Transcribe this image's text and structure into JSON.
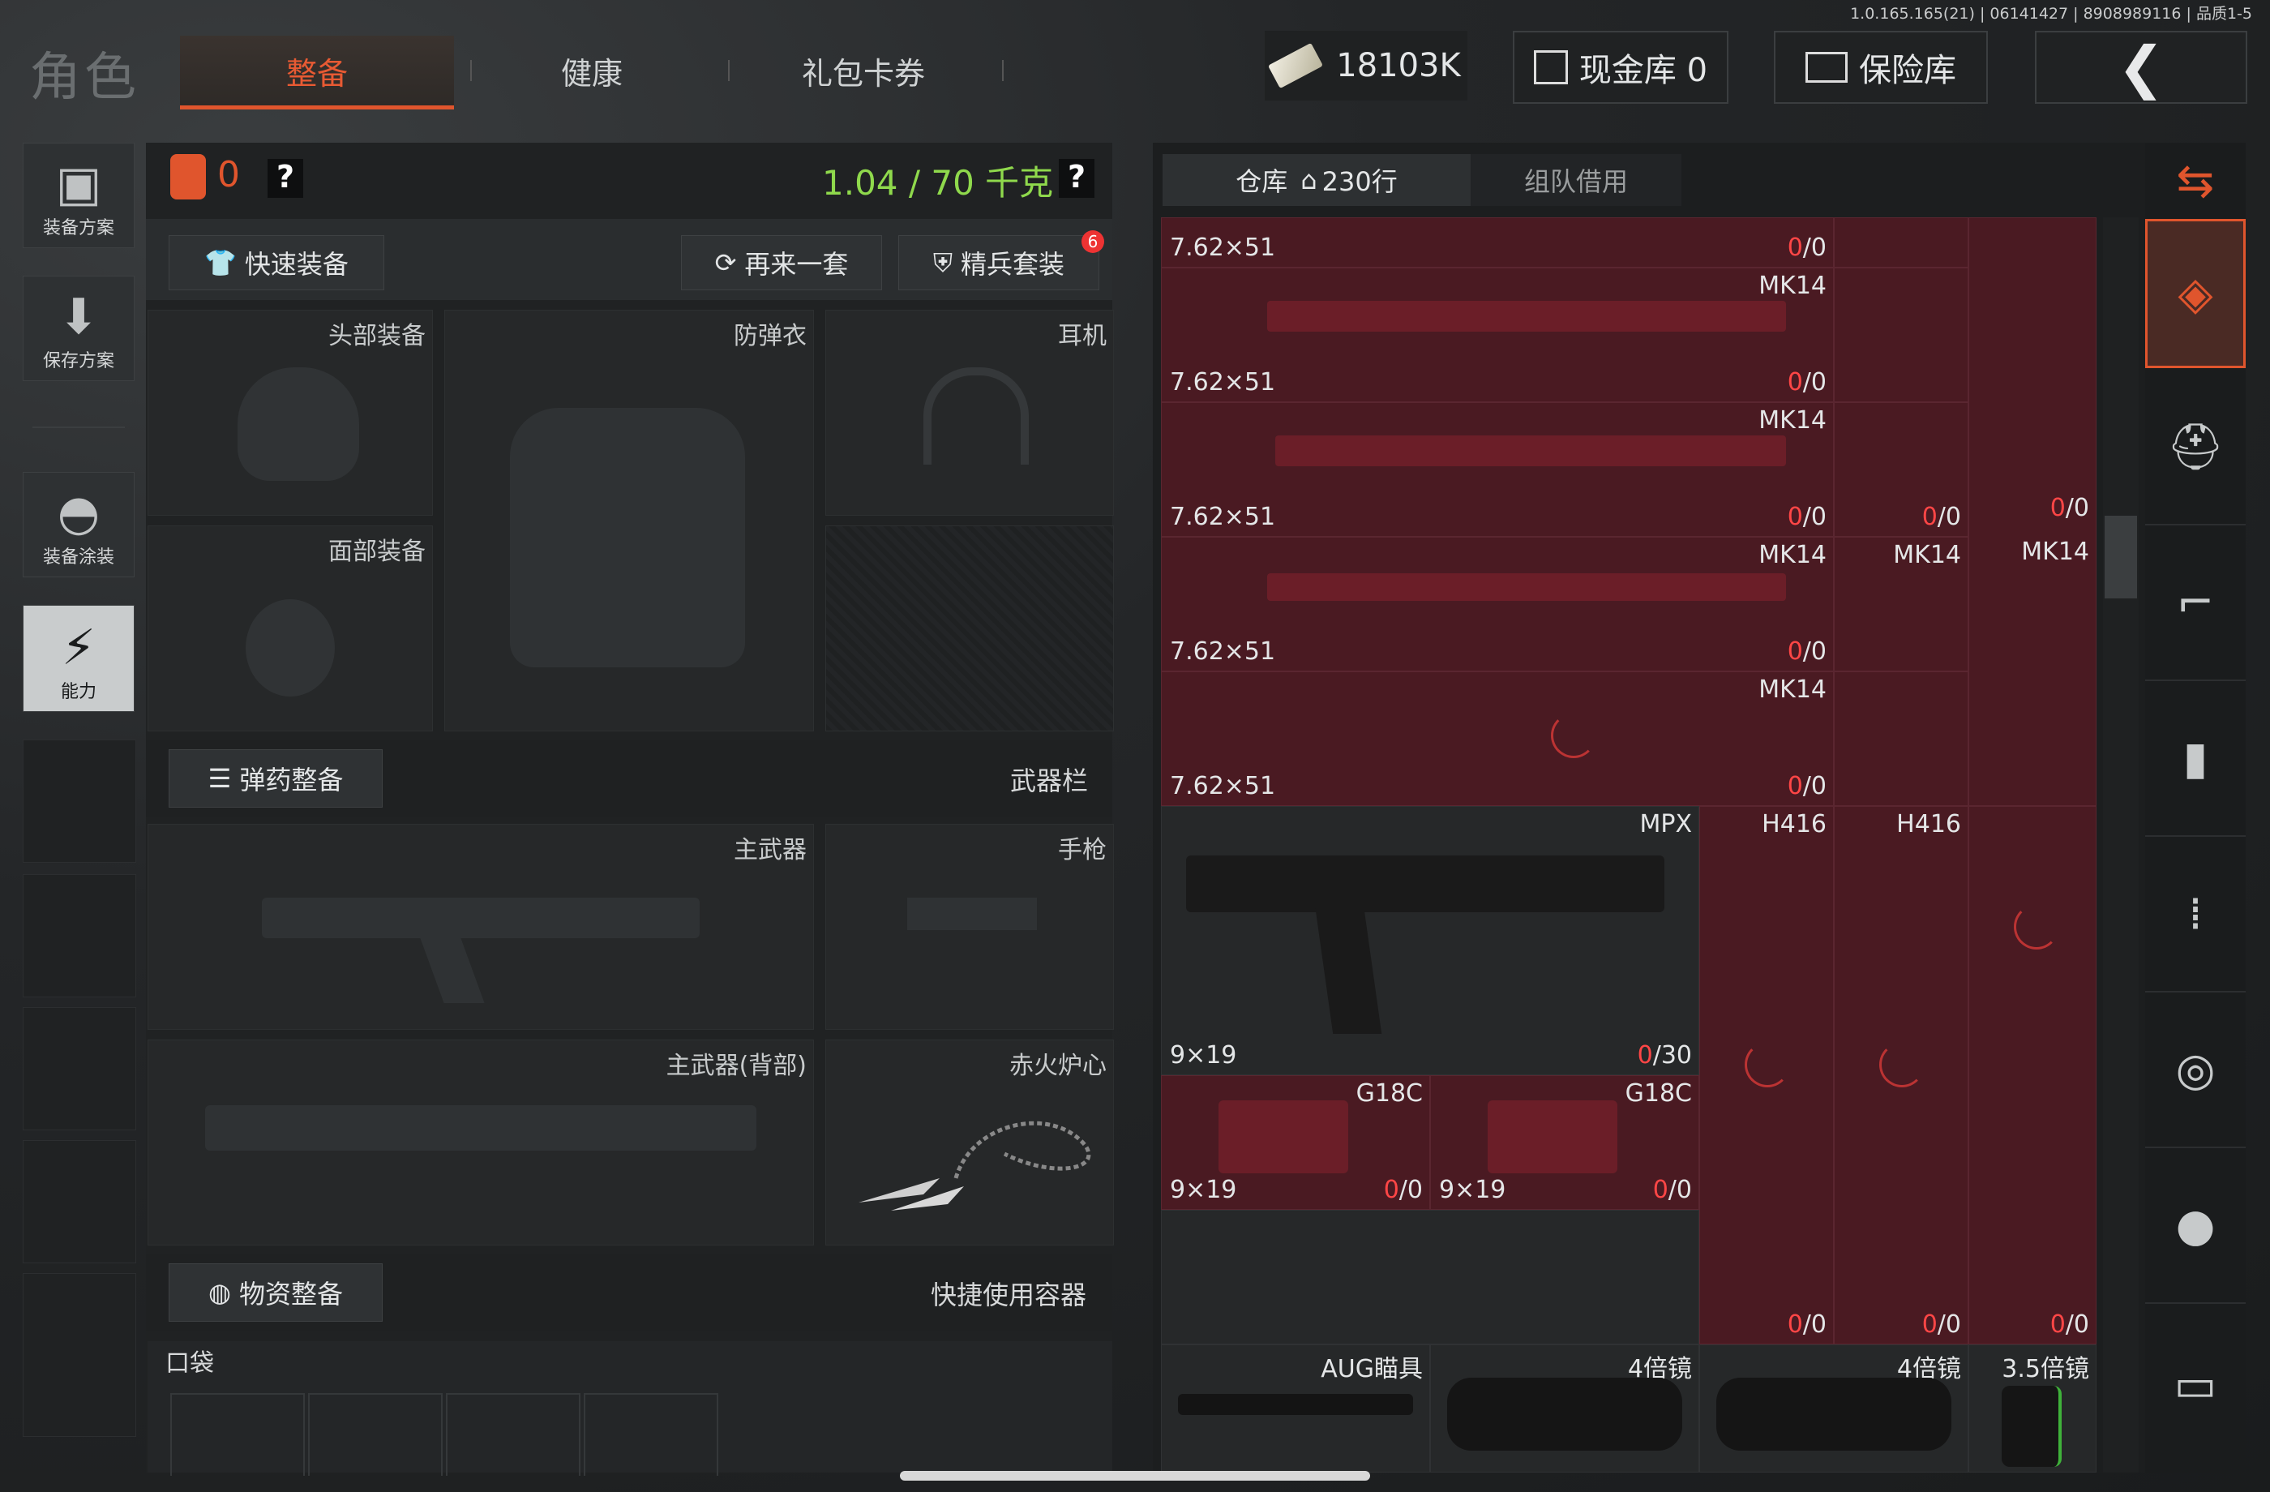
{
  "version": "1.0.165.165(21) | 06141427 | 8908989116 | 品质1-5",
  "nav": {
    "title": "角色",
    "tabs": [
      "整备",
      "健康",
      "礼包卡券"
    ]
  },
  "top": {
    "money": "18103K",
    "cash_vault": "现金库 0",
    "safe": "保险库"
  },
  "sidebar": [
    "装备方案",
    "保存方案",
    "装备涂装",
    "能力"
  ],
  "loadout": {
    "count": "0",
    "help": "?",
    "weight": "1.04 / 70 千克",
    "quick_equip": "快速装备",
    "again": "再来一套",
    "elite": "精兵套装",
    "elite_badge": "6",
    "slots": {
      "head": "头部装备",
      "armor": "防弹衣",
      "earphone": "耳机",
      "face": "面部装备"
    },
    "ammo_section": "弹药整备",
    "weapon_bar": "武器栏",
    "main_weapon": "主武器",
    "pistol": "手枪",
    "main_weapon_back": "主武器(背部)",
    "melee": "赤火炉心",
    "supply_section": "物资整备",
    "quick_container": "快捷使用容器",
    "pocket": "口袋"
  },
  "warehouse": {
    "tab_storage": "仓库",
    "rows": "230行",
    "tab_team": "组队借用",
    "c_762": "7.62×51",
    "c_919": "9×19",
    "zero": "0",
    "slash_zero": "/0",
    "slash_thirty": "/30",
    "mk14": "MK14",
    "mpx": "MPX",
    "h416": "H416",
    "g18c": "G18C",
    "aug_scope": "AUG瞄具",
    "scope4x": "4倍镜",
    "scope35x": "3.5倍镜"
  },
  "colors": {
    "accent": "#e0552d",
    "weight_green": "#8fd94c",
    "warehouse_red": "#4a1a22",
    "ammo_red": "#ff4646"
  },
  "icons": [
    "cash-stack-icon",
    "cash-vault-icon",
    "safe-icon",
    "back-arrow-icon",
    "vest-icon",
    "save-down-icon",
    "helmet-paint-icon",
    "ability-icon",
    "backpack-icon",
    "help-icon",
    "shirt-icon",
    "refresh-icon",
    "shield-icon",
    "ammo-list-icon",
    "supply-icon",
    "house-icon",
    "stack-sort-icon",
    "rifle-icon",
    "magazine-icon",
    "bullet-icon",
    "sight-icon",
    "grenade-icon",
    "camera-icon"
  ]
}
